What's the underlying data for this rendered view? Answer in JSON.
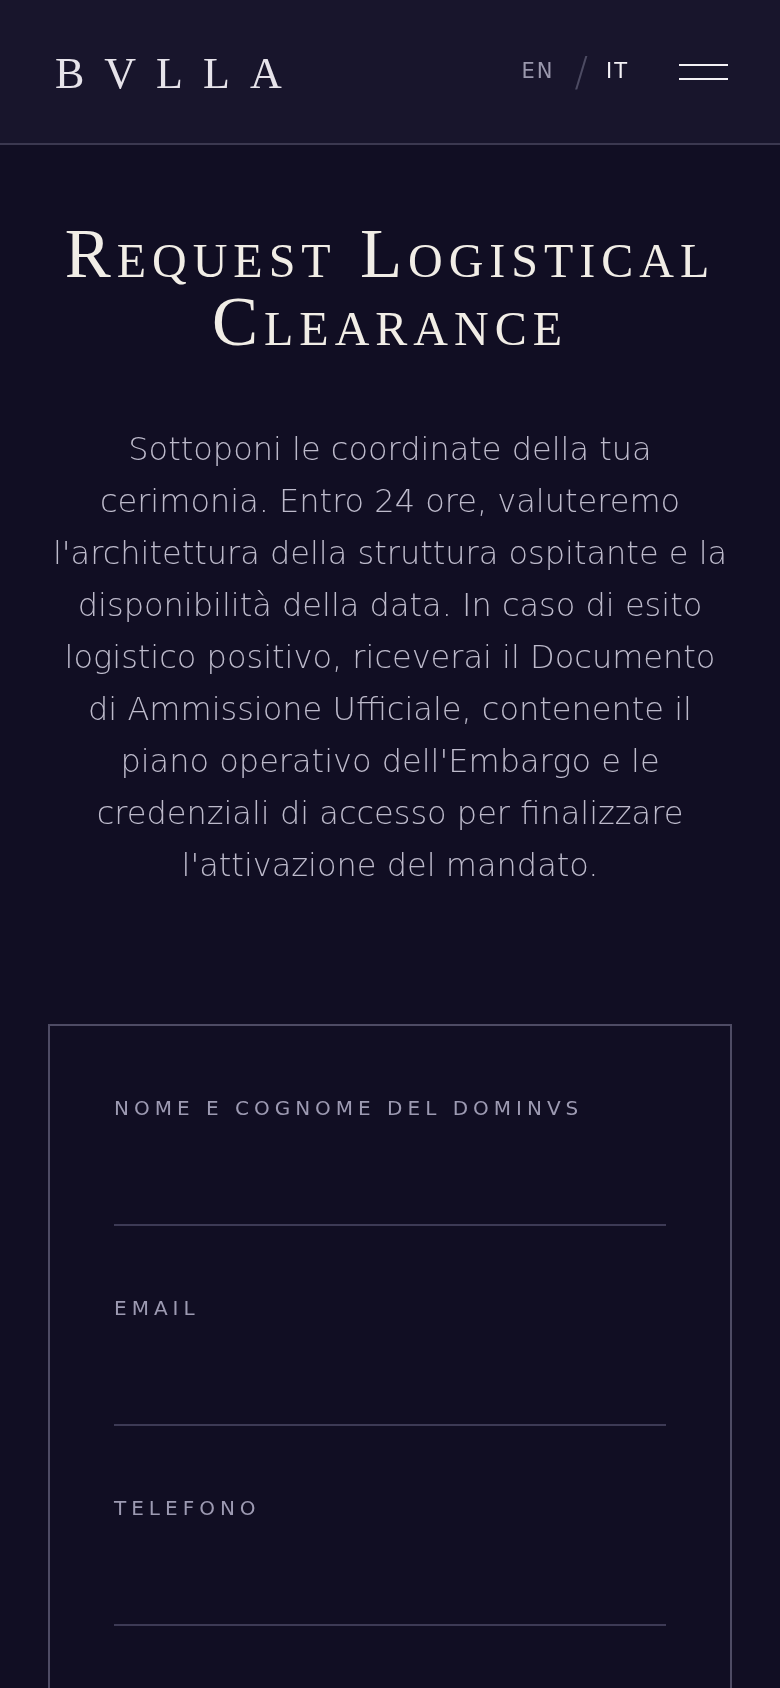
{
  "header": {
    "logo": "BVLLA",
    "languages": [
      {
        "label": "EN",
        "selected": false
      },
      {
        "label": "IT",
        "selected": true
      }
    ],
    "separator": "/"
  },
  "title": "Request Logistical Clearance",
  "intro": "Sottoponi le coordinate della tua cerimonia. Entro 24 ore, valuteremo l'architettura della struttura ospitante e la disponibilità della data. In caso di esito logistico positivo, riceverai il Documento di Ammissione Ufficiale, contenente il piano operativo dell'Embargo e le credenziali di accesso per finalizzare l'attivazione del mandato.",
  "form": {
    "fields": [
      {
        "label": "NOME E COGNOME DEL DOMINVS"
      },
      {
        "label": "EMAIL"
      },
      {
        "label": "TELEFONO"
      }
    ]
  }
}
